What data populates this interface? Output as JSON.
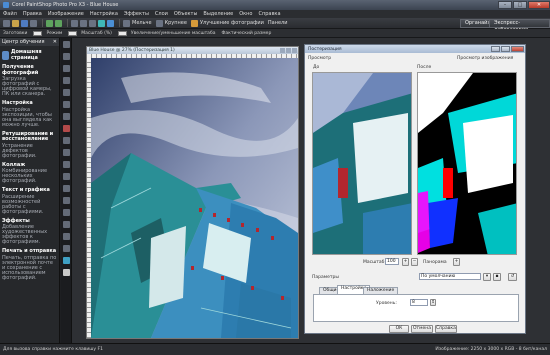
{
  "window": {
    "title": "Corel PaintShop Photo Pro X3 - Blue House"
  },
  "menu": [
    "Файл",
    "Правка",
    "Изображение",
    "Настройка",
    "Эффекты",
    "Слои",
    "Объекты",
    "Выделение",
    "Окно",
    "Справка"
  ],
  "toolbar": {
    "zoom_out": "Мельче",
    "zoom_in": "Крупнее",
    "enhance": "Улучшение фотографии",
    "panels": "Панели",
    "organizer": "Органайзер",
    "express": "Экспресс-лаборатория"
  },
  "toolbar2": {
    "preset": "Заготовки",
    "mode": "Режим",
    "zoom_label": "Масштаб (%)",
    "zoom_more": "Увеличение/уменьшение масштаба",
    "actual": "Фактический размер"
  },
  "learning_center": {
    "title": "Центр обучения",
    "home": "Домашняя страница",
    "sections": [
      {
        "title": "Получение фотографий",
        "desc": "Загрузка фотографий с цифровой камеры, ПК или сканера."
      },
      {
        "title": "Настройка",
        "desc": "Настройка экспозиции, чтобы она выглядела как можно лучше."
      },
      {
        "title": "Ретуширование и восстановление",
        "desc": "Устранение дефектов фотографии."
      },
      {
        "title": "Коллаж",
        "desc": "Комбинирование нескольких фотографий."
      },
      {
        "title": "Текст и графика",
        "desc": "Расширение возможностей работы с фотографиями."
      },
      {
        "title": "Эффекты",
        "desc": "Добавление художественных эффектов к фотографиям."
      },
      {
        "title": "Печать и отправка",
        "desc": "Печать, отправка по электронной почте и сохранение с использованием фотографий."
      }
    ]
  },
  "photo_window": {
    "title": "Blue House @ 27% (Постеризация 1)"
  },
  "dialog": {
    "title": "Постеризация",
    "preview_label": "Просмотр",
    "preview_on_image": "Просмотр изображения",
    "before": "До",
    "after": "После",
    "zoom_label": "Масштаб",
    "zoom_value": "100",
    "overview": "Панорама",
    "params_label": "Параметры",
    "preset_value": "По умолчанию",
    "tabs": [
      "Общие",
      "Настройки",
      "Наложение"
    ],
    "levels_label": "Уровень:",
    "levels_value": "8",
    "ok": "ОК",
    "cancel": "Отмена",
    "help": "Справка"
  },
  "status": {
    "left": "Для вызова справки нажмите клавишу F1",
    "right": "Изображение: 2250 x 3000 x RGB - 8 бит/канал"
  },
  "colors": {
    "accent": "#00c8c8",
    "app_bg": "#1e1f22",
    "dialog_bg": "#f0f0f0"
  }
}
